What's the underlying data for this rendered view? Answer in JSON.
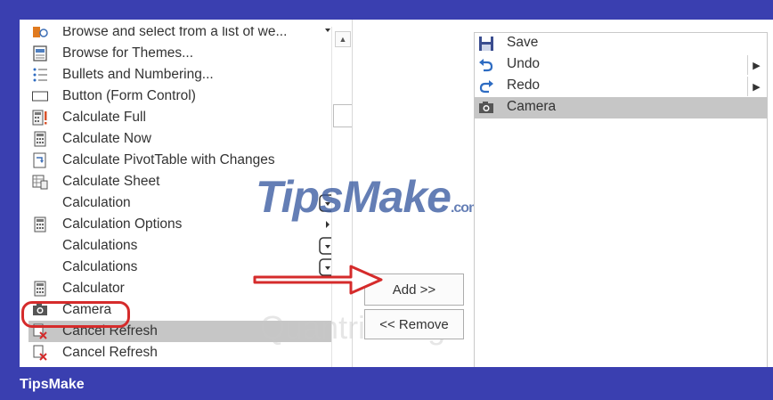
{
  "left_list": {
    "items": [
      {
        "label": "Browse and select from a list of we...",
        "icon": "browse-list-icon"
      },
      {
        "label": "Browse for Themes...",
        "icon": "themes-icon"
      },
      {
        "label": "Bullets and Numbering...",
        "icon": "bullets-icon"
      },
      {
        "label": "Button (Form Control)",
        "icon": "button-control-icon"
      },
      {
        "label": "Calculate Full",
        "icon": "calculate-full-icon"
      },
      {
        "label": "Calculate Now",
        "icon": "calculator-icon"
      },
      {
        "label": "Calculate PivotTable with Changes",
        "icon": "pivot-icon"
      },
      {
        "label": "Calculate Sheet",
        "icon": "calculate-sheet-icon"
      },
      {
        "label": "Calculation",
        "icon": ""
      },
      {
        "label": "Calculation Options",
        "icon": "calculator-icon"
      },
      {
        "label": "Calculations",
        "icon": ""
      },
      {
        "label": "Calculations",
        "icon": ""
      },
      {
        "label": "Calculator",
        "icon": "calculator-icon"
      },
      {
        "label": "Camera",
        "icon": "camera-icon"
      },
      {
        "label": "Cancel Refresh",
        "icon": "cancel-refresh-icon"
      },
      {
        "label": "Cancel Refresh",
        "icon": "cancel-refresh-icon"
      }
    ]
  },
  "buttons": {
    "add": "Add >>",
    "remove": "<< Remove"
  },
  "right_list": {
    "items": [
      {
        "label": "Save",
        "icon": "save-icon",
        "submenu": false
      },
      {
        "label": "Undo",
        "icon": "undo-icon",
        "submenu": true
      },
      {
        "label": "Redo",
        "icon": "redo-icon",
        "submenu": true
      },
      {
        "label": "Camera",
        "icon": "camera-icon",
        "submenu": false,
        "selected": true
      }
    ],
    "submenu_glyph": "▶"
  },
  "watermark": {
    "brand": "TipsMake",
    "domain": ".com",
    "secondary": "Quantrimang"
  },
  "footer": {
    "brand": "TipsMake"
  },
  "colors": {
    "frame": "#3a3fb0",
    "selection": "#c6c6c6",
    "highlight_ring": "#d52b2b"
  }
}
